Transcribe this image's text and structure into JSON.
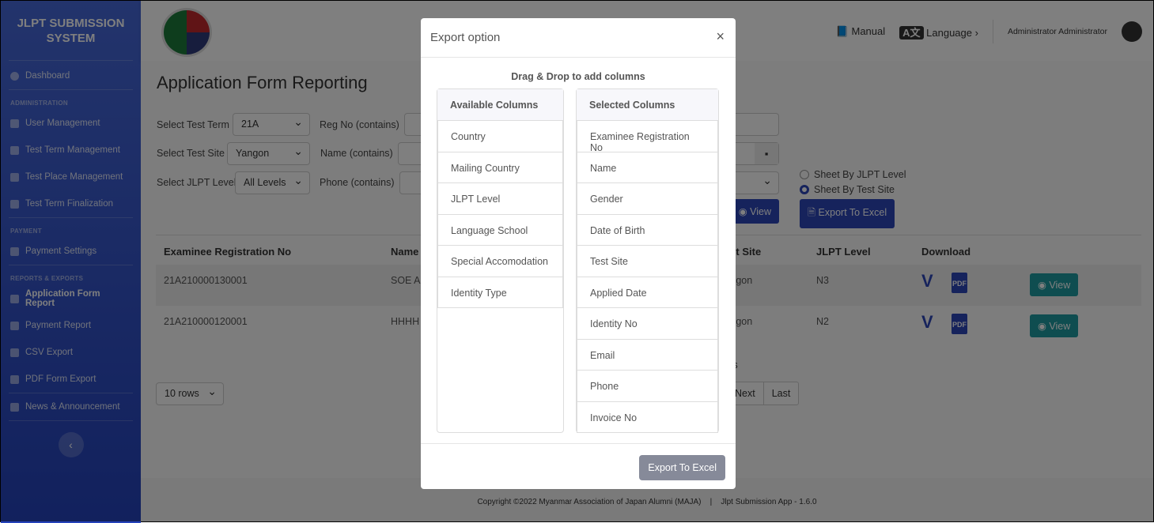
{
  "sidebar": {
    "brand": "JLPT SUBMISSION SYSTEM",
    "dashboard": "Dashboard",
    "sec_admin": "ADMINISTRATION",
    "admin": [
      "User Management",
      "Test Term Management",
      "Test Place Management",
      "Test Term Finalization"
    ],
    "sec_payment": "PAYMENT",
    "payment": [
      "Payment Settings"
    ],
    "sec_reports": "REPORTS & EXPORTS",
    "reports": [
      "Application Form Report",
      "Payment Report",
      "CSV Export",
      "PDF Form Export"
    ],
    "news": "News & Announcement",
    "collapse_icon": "chevron-left"
  },
  "topbar": {
    "manual": "Manual",
    "language": "Language",
    "user": "Administrator Administrator"
  },
  "page": {
    "title": "Application Form Reporting",
    "filters": {
      "term_label": "Select Test Term",
      "term_value": "21A",
      "site_label": "Select Test Site",
      "site_value": "Yangon",
      "level_label": "Select JLPT Level",
      "level_value": "All Levels",
      "reg_label": "Reg No (contains)",
      "name_label": "Name (contains)",
      "phone_label": "Phone (contains)"
    },
    "radio": {
      "by_level": "Sheet By JLPT Level",
      "by_site": "Sheet By Test Site",
      "selected": "Sheet By Test Site"
    },
    "view_label": "View",
    "export_label": "Export To Excel",
    "table": {
      "headers": [
        "Examinee Registration No",
        "Name",
        "Test Site",
        "JLPT Level",
        "Download"
      ],
      "rows": [
        {
          "reg": "21A210000130001",
          "name": "SOE A",
          "site": "Yangon",
          "level": "N3"
        },
        {
          "reg": "21A210000120001",
          "name": "HHHH",
          "site": "Yangon",
          "level": "N2"
        }
      ],
      "pdf": "PDF",
      "view": "View"
    },
    "info_fragment": "ts",
    "rows_select": "10 rows",
    "pager": [
      "Next",
      "Last"
    ]
  },
  "footer": {
    "copyright": "Copyright ©2022 Myanmar Association of Japan Alumni (MAJA)",
    "sep": "|",
    "app": "Jlpt Submission App - 1.6.0"
  },
  "modal": {
    "title": "Export option",
    "close": "×",
    "instruction": "Drag & Drop to add columns",
    "available_title": "Available Columns",
    "available": [
      "Country",
      "Mailing Country",
      "JLPT Level",
      "Language School",
      "Special Accomodation",
      "Identity Type"
    ],
    "selected_title": "Selected Columns",
    "selected": [
      "Examinee Registration No",
      "Name",
      "Gender",
      "Date of Birth",
      "Test Site",
      "Applied Date",
      "Identity No",
      "Email",
      "Phone",
      "Invoice No"
    ],
    "export": "Export To Excel"
  }
}
